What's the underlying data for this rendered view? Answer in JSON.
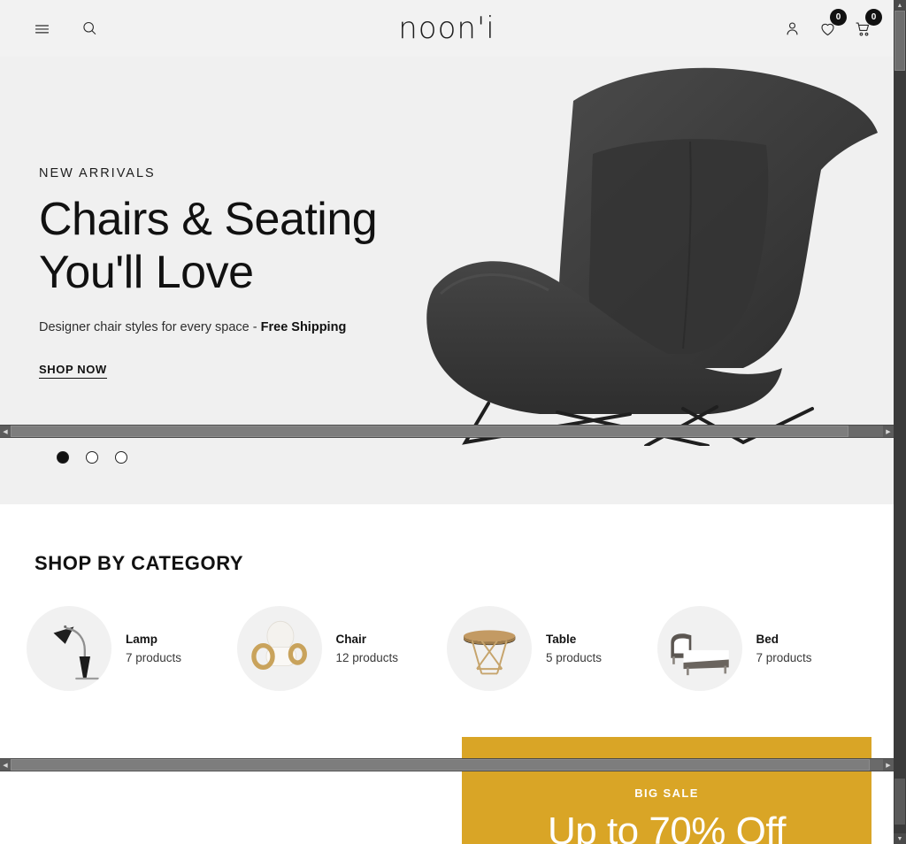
{
  "header": {
    "menu_label": "menu-icon",
    "search_label": "search-icon",
    "logo": "noon'i",
    "account_label": "account-icon",
    "wishlist_count": "0",
    "cart_count": "0"
  },
  "hero": {
    "eyebrow": "NEW ARRIVALS",
    "title_line1": "Chairs & Seating",
    "title_line2": "You'll Love",
    "subtitle_plain": "Designer chair styles for every space - ",
    "subtitle_bold": "Free Shipping",
    "cta": "SHOP NOW",
    "slides": [
      {
        "index": "1",
        "active": true
      },
      {
        "index": "2",
        "active": false
      },
      {
        "index": "3",
        "active": false
      }
    ],
    "image_alt": "dark grey designer lounge chair"
  },
  "categories": {
    "title": "SHOP BY CATEGORY",
    "items": [
      {
        "name": "Lamp",
        "count": "7 products",
        "icon": "lamp-thumbnail"
      },
      {
        "name": "Chair",
        "count": "12 products",
        "icon": "chair-thumbnail"
      },
      {
        "name": "Table",
        "count": "5 products",
        "icon": "table-thumbnail"
      },
      {
        "name": "Bed",
        "count": "7 products",
        "icon": "bed-thumbnail"
      }
    ]
  },
  "sale_banner": {
    "kicker": "BIG SALE",
    "headline": "Up to 70% Off",
    "background_color": "#d9a526"
  },
  "scrollbars": {
    "left_arrow": "◀",
    "right_arrow": "▶",
    "up_arrow": "▲",
    "down_arrow": "▼"
  },
  "colors": {
    "page_bg": "#ffffff",
    "header_bg": "#f2f2f2",
    "hero_bg": "#f0f0f0",
    "accent": "#d9a526",
    "text": "#111111",
    "chair": "#3c3c3c"
  }
}
